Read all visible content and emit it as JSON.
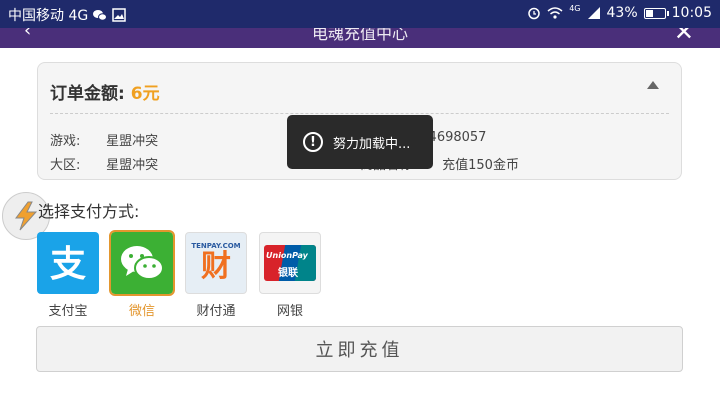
{
  "status_bar": {
    "carrier": "中国移动 4G",
    "network_badge": "4G",
    "battery": "43%",
    "battery_level": 0.43,
    "time": "10:05",
    "icons": [
      "wechat-icon",
      "image-icon",
      "alarm-icon",
      "wifi-icon",
      "signal-icon",
      "battery-icon"
    ]
  },
  "header": {
    "title": "电魂充值中心",
    "back_icon": "back-arrow-icon",
    "close_icon": "close-icon"
  },
  "order": {
    "amount_label": "订单金额:",
    "amount_value": "6元",
    "game_label": "游戏:",
    "game_value": "星盟冲突",
    "region_label": "大区:",
    "region_value": "星盟冲突",
    "account_value": "164698057",
    "product_label": "商品名称:",
    "product_value": "充值150金币"
  },
  "toast": {
    "text": "努力加载中..."
  },
  "payment": {
    "title": "选择支付方式:",
    "options": [
      {
        "label": "支付宝",
        "icon": "alipay-icon"
      },
      {
        "label": "微信",
        "icon": "wechat-pay-icon",
        "selected": true
      },
      {
        "label": "财付通",
        "icon": "tenpay-icon",
        "logo_text": "TENPAY.COM",
        "logo_glyph": "财"
      },
      {
        "label": "网银",
        "icon": "unionpay-icon",
        "logo_text": "UnionPay",
        "logo_sub": "银联"
      }
    ]
  },
  "charge_button": {
    "label": "立即充值"
  },
  "colors": {
    "accent": "#e3962e",
    "amount": "#f0a020",
    "status_bar": "#1f2a6b",
    "header": "#4a2f7a"
  }
}
